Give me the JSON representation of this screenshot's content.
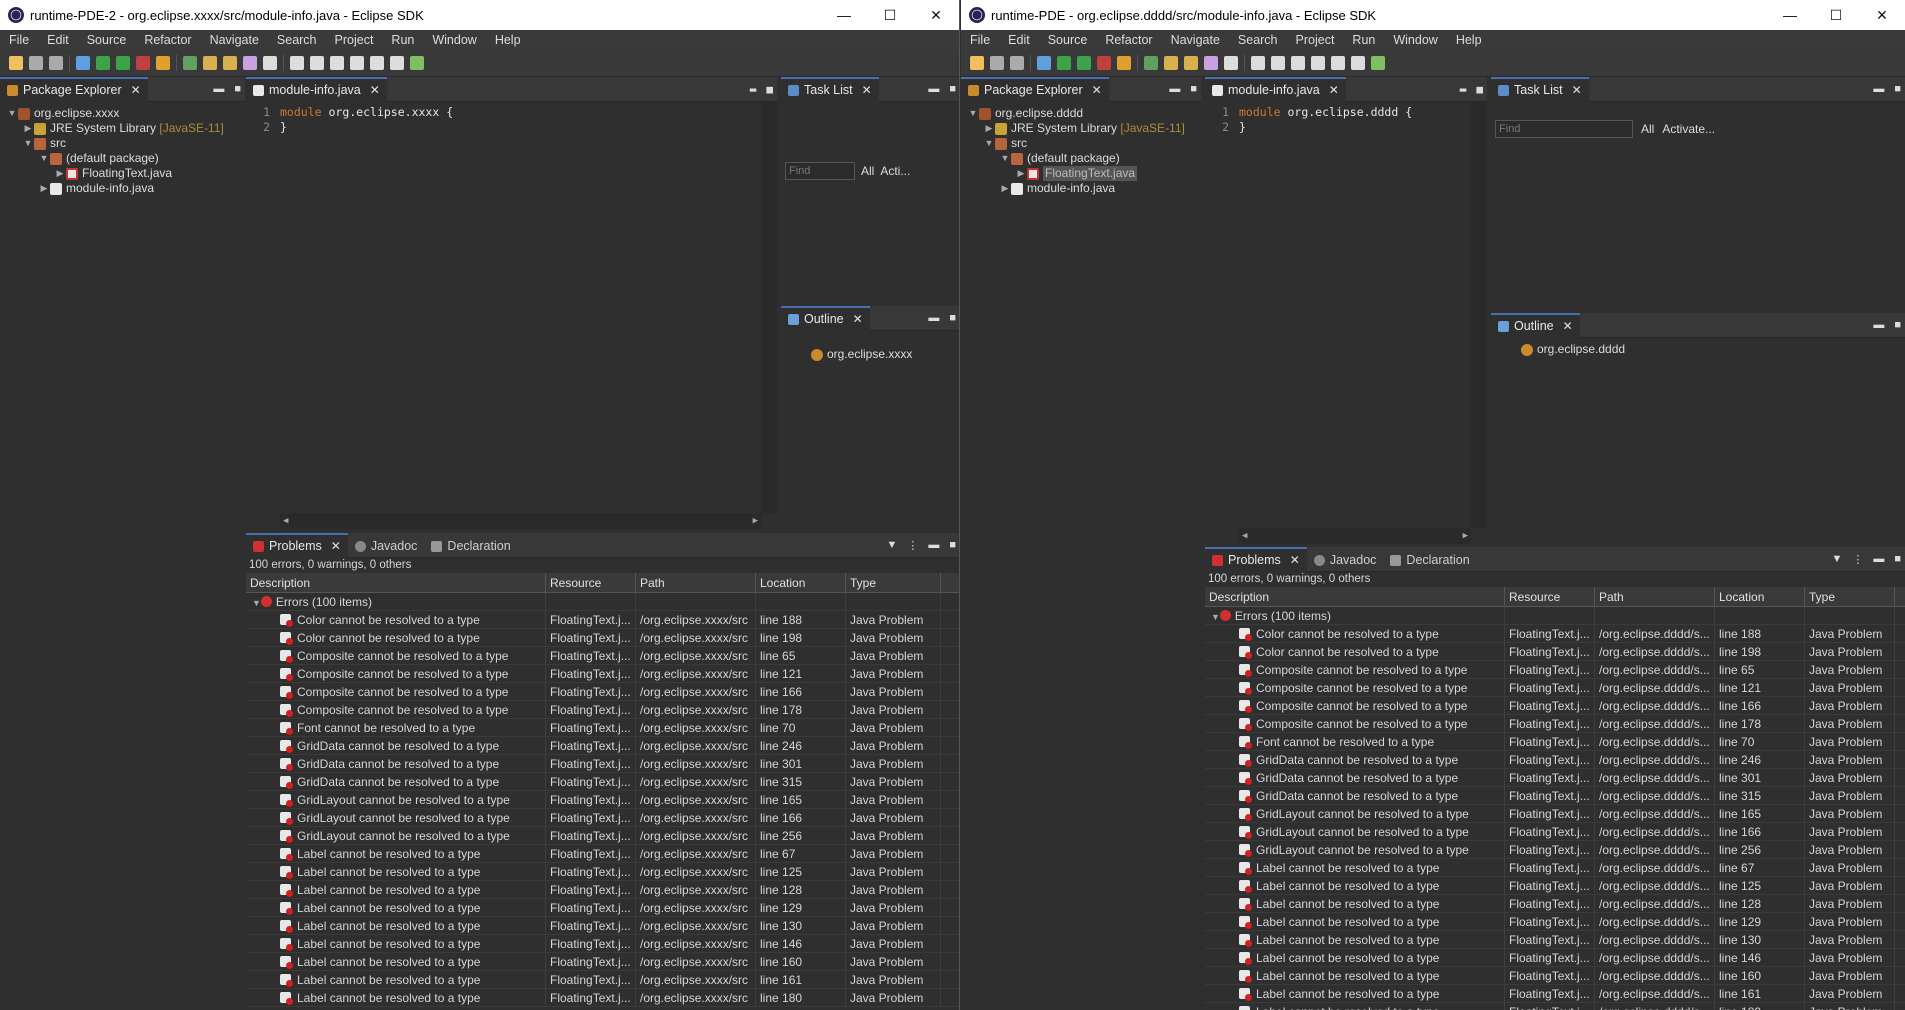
{
  "windows": [
    {
      "title": "runtime-PDE-2 - org.eclipse.xxxx/src/module-info.java - Eclipse SDK",
      "project": "org.eclipse.xxxx",
      "path": "/org.eclipse.xxxx/src",
      "code_module": "org.eclipse.xxxx",
      "outline_item": "org.eclipse.xxxx",
      "find_placeholder": "Find",
      "tasklist_all": "All",
      "tasklist_activate": "Acti..."
    },
    {
      "title": "runtime-PDE - org.eclipse.dddd/src/module-info.java - Eclipse SDK",
      "project": "org.eclipse.dddd",
      "path": "/org.eclipse.dddd/s...",
      "code_module": "org.eclipse.dddd",
      "outline_item": "org.eclipse.dddd",
      "find_placeholder": "Find",
      "tasklist_all": "All",
      "tasklist_activate": "Activate..."
    }
  ],
  "window_controls": {
    "minimize": "—",
    "maximize": "☐",
    "close": "✕"
  },
  "menu": [
    "File",
    "Edit",
    "Source",
    "Refactor",
    "Navigate",
    "Search",
    "Project",
    "Run",
    "Window",
    "Help"
  ],
  "tabs": {
    "package_explorer": "Package Explorer",
    "editor": "module-info.java",
    "task_list": "Task List",
    "outline": "Outline",
    "problems": "Problems",
    "javadoc": "Javadoc",
    "declaration": "Declaration"
  },
  "tree": {
    "jre": "JRE System Library",
    "jre_version": "[JavaSE-11]",
    "src": "src",
    "default_package": "(default package)",
    "floating_text": "FloatingText.java",
    "module_info": "module-info.java"
  },
  "code": {
    "line1": "1",
    "line2": "2",
    "keyword": "module",
    "brace_open": "{",
    "brace_close": "}"
  },
  "problems": {
    "summary": "100 errors, 0 warnings, 0 others",
    "columns": [
      "Description",
      "Resource",
      "Path",
      "Location",
      "Type"
    ],
    "group": "Errors (100 items)",
    "resource": "FloatingText.j...",
    "type": "Java Problem",
    "rows": [
      {
        "desc": "Color cannot be resolved to a type",
        "loc": "line 188"
      },
      {
        "desc": "Color cannot be resolved to a type",
        "loc": "line 198"
      },
      {
        "desc": "Composite cannot be resolved to a type",
        "loc": "line 65"
      },
      {
        "desc": "Composite cannot be resolved to a type",
        "loc": "line 121"
      },
      {
        "desc": "Composite cannot be resolved to a type",
        "loc": "line 166"
      },
      {
        "desc": "Composite cannot be resolved to a type",
        "loc": "line 178"
      },
      {
        "desc": "Font cannot be resolved to a type",
        "loc": "line 70"
      },
      {
        "desc": "GridData cannot be resolved to a type",
        "loc": "line 246"
      },
      {
        "desc": "GridData cannot be resolved to a type",
        "loc": "line 301"
      },
      {
        "desc": "GridData cannot be resolved to a type",
        "loc": "line 315"
      },
      {
        "desc": "GridLayout cannot be resolved to a type",
        "loc": "line 165"
      },
      {
        "desc": "GridLayout cannot be resolved to a type",
        "loc": "line 166"
      },
      {
        "desc": "GridLayout cannot be resolved to a type",
        "loc": "line 256"
      },
      {
        "desc": "Label cannot be resolved to a type",
        "loc": "line 67"
      },
      {
        "desc": "Label cannot be resolved to a type",
        "loc": "line 125"
      },
      {
        "desc": "Label cannot be resolved to a type",
        "loc": "line 128"
      },
      {
        "desc": "Label cannot be resolved to a type",
        "loc": "line 129"
      },
      {
        "desc": "Label cannot be resolved to a type",
        "loc": "line 130"
      },
      {
        "desc": "Label cannot be resolved to a type",
        "loc": "line 146"
      },
      {
        "desc": "Label cannot be resolved to a type",
        "loc": "line 160"
      },
      {
        "desc": "Label cannot be resolved to a type",
        "loc": "line 161"
      },
      {
        "desc": "Label cannot be resolved to a type",
        "loc": "line 180"
      }
    ]
  }
}
